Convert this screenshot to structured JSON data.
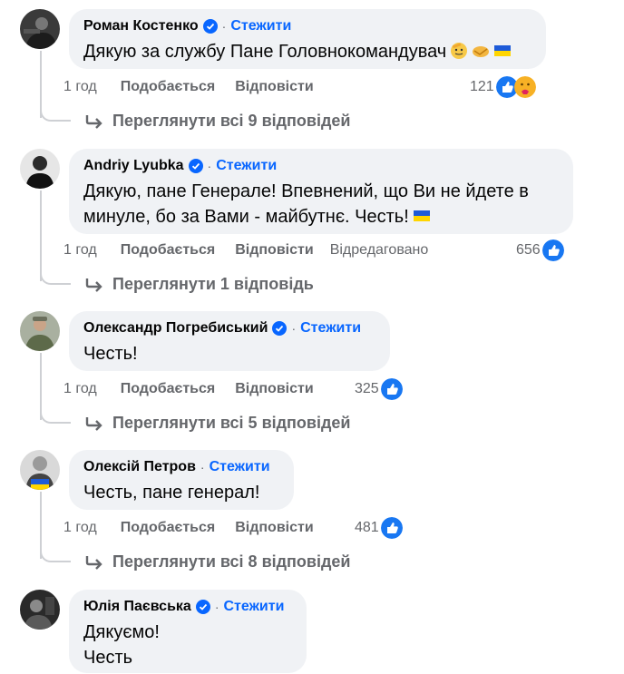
{
  "colors": {
    "accent": "#0866ff",
    "like_blue": "#1877f2",
    "muted": "#65676b",
    "bubble": "#f0f2f5"
  },
  "comments": [
    {
      "author": "Роман Костенко",
      "verified": true,
      "follow_label": "Стежити",
      "text": "Дякую за службу Пане Головнокомандувач",
      "emojis": [
        "saluting-face-emoji",
        "handshake-emoji",
        "ukraine-flag-emoji"
      ],
      "time": "1 год",
      "like_label": "Подобається",
      "reply_label": "Відповісти",
      "edited_label": "",
      "reaction_count": "121",
      "reactions": [
        "like",
        "care"
      ],
      "view_replies": "Переглянути всі 9 відповідей"
    },
    {
      "author": "Andriy Lyubka",
      "verified": true,
      "follow_label": "Стежити",
      "text": "Дякую, пане Генерале! Впевнений, що Ви не йдете в\nминуле, бо за Вами - майбутнє. Честь!",
      "emojis": [
        "ukraine-flag-emoji"
      ],
      "time": "1 год",
      "like_label": "Подобається",
      "reply_label": "Відповісти",
      "edited_label": "Відредаговано",
      "reaction_count": "656",
      "reactions": [
        "like"
      ],
      "view_replies": "Переглянути 1 відповідь"
    },
    {
      "author": "Олександр Погребиський",
      "verified": true,
      "follow_label": "Стежити",
      "text": "Честь!",
      "emojis": [],
      "time": "1 год",
      "like_label": "Подобається",
      "reply_label": "Відповісти",
      "edited_label": "",
      "reaction_count": "325",
      "reactions": [
        "like"
      ],
      "view_replies": "Переглянути всі 5 відповідей"
    },
    {
      "author": "Олексій Петров",
      "verified": false,
      "follow_label": "Стежити",
      "text": "Честь, пане генерал!",
      "emojis": [],
      "time": "1 год",
      "like_label": "Подобається",
      "reply_label": "Відповісти",
      "edited_label": "",
      "reaction_count": "481",
      "reactions": [
        "like"
      ],
      "view_replies": "Переглянути всі 8 відповідей"
    },
    {
      "author": "Юлія Паєвська",
      "verified": true,
      "follow_label": "Стежити",
      "text": "Дякуємо!\nЧесть",
      "emojis": []
    }
  ]
}
